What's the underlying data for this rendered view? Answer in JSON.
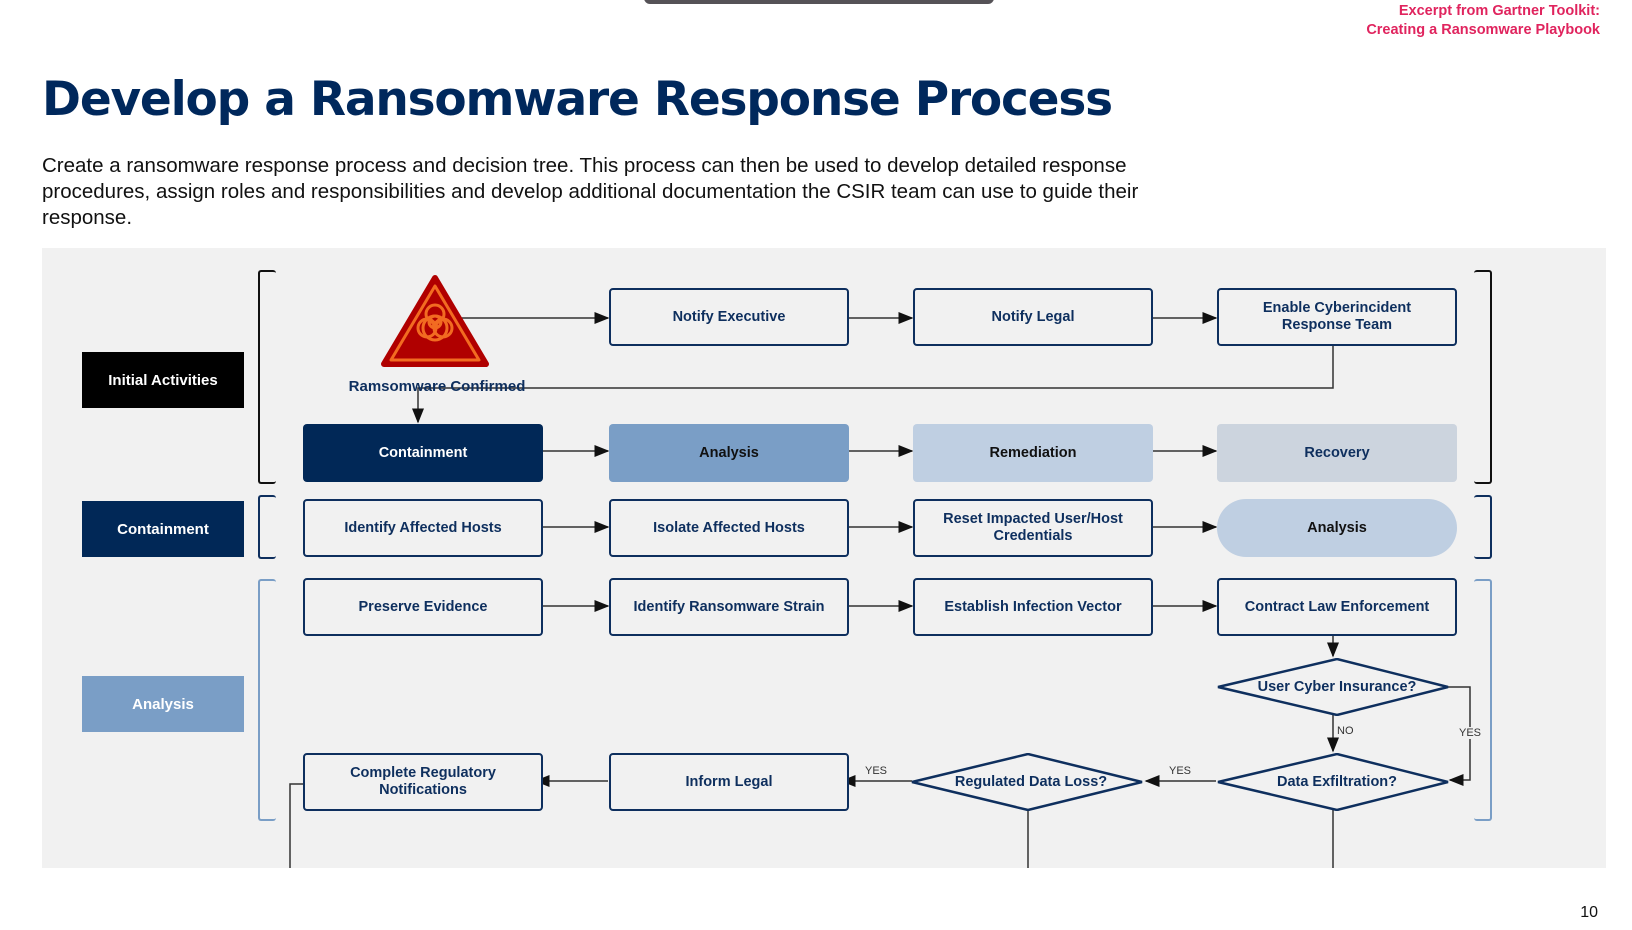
{
  "excerpt": {
    "line1": "Excerpt from Gartner Toolkit:",
    "line2": "Creating a Ransomware Playbook"
  },
  "title": "Develop a Ransomware Response Process",
  "intro": "Create a ransomware response process and decision tree. This process can then be used to develop detailed response procedures, assign roles and responsibilities and develop additional documentation the CSIR team can use to guide their response.",
  "colors": {
    "title": "#00285c",
    "excerpt": "#e0245e",
    "lane_initial": "#000000",
    "lane_containment": "#012857",
    "lane_analysis": "#7a9ec6",
    "phase_containment": "#012857",
    "phase_analysis": "#7a9ec6",
    "phase_remediation": "#bfcfe2",
    "phase_recovery": "#ccd4de",
    "hazard_red": "#b00000",
    "hazard_orange": "#f26b21"
  },
  "lanes": {
    "initial": "Initial Activities",
    "containment": "Containment",
    "analysis": "Analysis"
  },
  "initial": {
    "trigger": "Ramsomware Confirmed",
    "trigger_icon": "biohazard-warning-icon",
    "notify_executive": "Notify Executive",
    "notify_legal": "Notify Legal",
    "enable_csirt": "Enable Cyberincident Response Team"
  },
  "phases": {
    "containment": "Containment",
    "analysis": "Analysis",
    "remediation": "Remediation",
    "recovery": "Recovery"
  },
  "containment_steps": {
    "identify_hosts": "Identify Affected Hosts",
    "isolate_hosts": "Isolate Affected Hosts",
    "reset_credentials": "Reset Impacted User/Host Credentials",
    "next_analysis": "Analysis"
  },
  "analysis_steps": {
    "preserve_evidence": "Preserve Evidence",
    "identify_strain": "Identify Ransomware Strain",
    "infection_vector": "Establish Infection Vector",
    "law_enforcement": "Contract Law Enforcement",
    "decision_insurance": "User Cyber Insurance?",
    "decision_exfiltration": "Data Exfiltration?",
    "decision_regulated": "Regulated Data Loss?",
    "inform_legal": "Inform Legal",
    "regulatory_notifications": "Complete Regulatory Notifications"
  },
  "edge_labels": {
    "no": "NO",
    "yes": "YES"
  },
  "page_number": "10"
}
